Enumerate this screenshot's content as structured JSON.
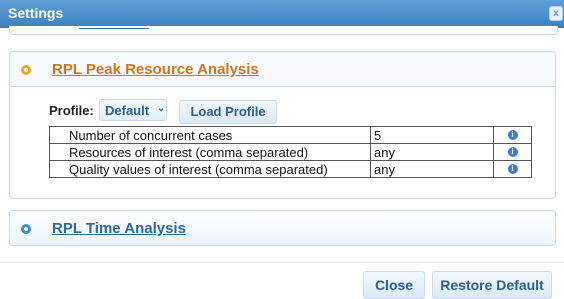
{
  "window": {
    "title": "Settings",
    "close_glyph": "x"
  },
  "sections": {
    "peak": {
      "title": "RPL Peak Resource Analysis",
      "state": "expanded",
      "bullet_color": "#f5a623",
      "title_color": "#d4741a"
    },
    "time": {
      "title": "RPL Time Analysis",
      "state": "collapsed",
      "bullet_color": "#3a8fd6",
      "title_color": "#2c6aa0"
    }
  },
  "profile": {
    "label": "Profile:",
    "selected": "Default",
    "load_button": "Load Profile"
  },
  "parameters": [
    {
      "name": "Number of concurrent cases",
      "value": "5",
      "icon": "info-icon"
    },
    {
      "name": "Resources of interest (comma separated)",
      "value": "any",
      "icon": "info-icon"
    },
    {
      "name": "Quality values of interest (comma separated)",
      "value": "any",
      "icon": "info-icon"
    }
  ],
  "footer": {
    "close": "Close",
    "restore": "Restore Default"
  },
  "colors": {
    "accent": "#3d83c1",
    "border": "#c5dbec",
    "button_text": "#2b5f93"
  }
}
